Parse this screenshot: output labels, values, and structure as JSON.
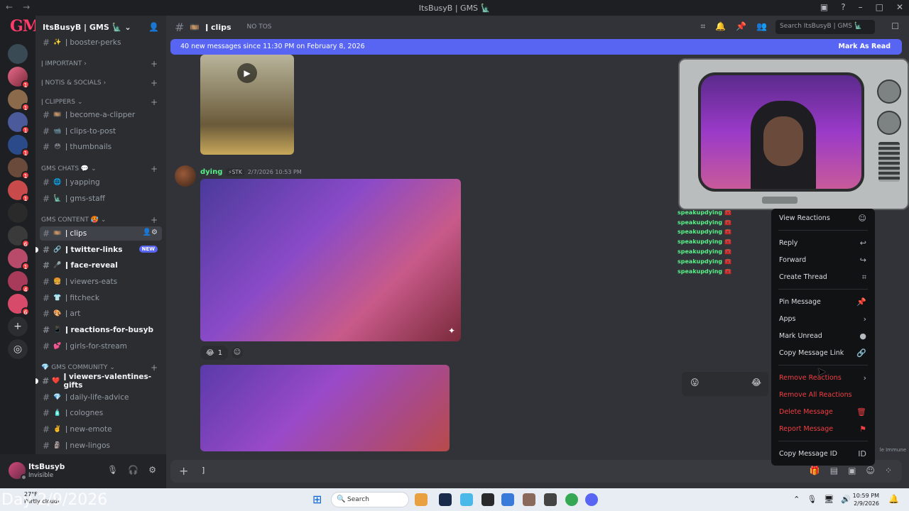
{
  "window": {
    "title": "ItsBusyB | GMS 🗽"
  },
  "server": {
    "name": "ItsBusyB | GMS 🗽"
  },
  "rail_badges": [
    "1",
    "1",
    "1",
    "1",
    "1",
    "1",
    "6",
    "1",
    "4",
    "6"
  ],
  "sidebar": {
    "channels_top": [
      {
        "emoji": "✨",
        "label": "ǀ booster-perks"
      }
    ],
    "categories": {
      "important": "ǀ IMPORTANT",
      "notis": "ǀ NOTIS & SOCIALS",
      "clippers": "ǀ CLIPPERS",
      "chats": "GMS CHATS 💬",
      "content": "GMS CONTENT 🥵",
      "community": "GMS COMMUNITY"
    },
    "clippers": [
      {
        "emoji": "🎞️",
        "label": "ǀ become-a-clipper"
      },
      {
        "emoji": "📹",
        "label": "ǀ clips-to-post"
      },
      {
        "emoji": "😳",
        "label": "ǀ thumbnails"
      }
    ],
    "chats": [
      {
        "emoji": "🌐",
        "label": "ǀ yapping"
      },
      {
        "emoji": "🗽",
        "label": "ǀ gms-staff"
      }
    ],
    "content": [
      {
        "emoji": "🎞️",
        "label": "ǀ clips"
      },
      {
        "emoji": "🔗",
        "label": "ǀ twitter-links",
        "badge": "NEW"
      },
      {
        "emoji": "🎤",
        "label": "ǀ face-reveal"
      },
      {
        "emoji": "🍔",
        "label": "ǀ viewers-eats"
      },
      {
        "emoji": "👕",
        "label": "ǀ fitcheck"
      },
      {
        "emoji": "🎨",
        "label": "ǀ art"
      },
      {
        "emoji": "📱",
        "label": "ǀ reactions-for-busyb"
      },
      {
        "emoji": "💕",
        "label": "ǀ girls-for-stream"
      }
    ],
    "community": [
      {
        "emoji": "❤️",
        "label": "ǀ viewers-valentines-gifts"
      },
      {
        "emoji": "💎",
        "label": "ǀ daily-life-advice"
      },
      {
        "emoji": "🧴",
        "label": "ǀ colognes"
      },
      {
        "emoji": "✌️",
        "label": "ǀ new-emote"
      },
      {
        "emoji": "🗿",
        "label": "ǀ new-lingos"
      }
    ]
  },
  "user": {
    "name": "ItsBusyb",
    "status": "Invisible"
  },
  "channel": {
    "name": "ǀ clips",
    "topic": "NO TOS",
    "search_placeholder": "Search ItsBusyB | GMS 🗽"
  },
  "new_messages": {
    "text": "40 new messages since 11:30 PM on February 8, 2026",
    "mark": "Mark As Read"
  },
  "message": {
    "author": "dying",
    "tag": "⚡STK",
    "time": "2/7/2026 10:53 PM",
    "reaction_emoji": "😂",
    "reaction_count": "1"
  },
  "speakup_lines": [
    "speakupdying 🧰",
    "speakupdying 🧰",
    "speakupdying 🧰",
    "speakupdying 🧰",
    "speakupdying 🧰",
    "speakupdying 🧰",
    "speakupdying 🧰"
  ],
  "context_menu": {
    "view_reactions": "View Reactions",
    "reply": "Reply",
    "forward": "Forward",
    "create_thread": "Create Thread",
    "pin": "Pin Message",
    "apps": "Apps",
    "mark_unread": "Mark Unread",
    "copy_link": "Copy Message Link",
    "remove_reactions": "Remove Reactions",
    "remove_all": "Remove All Reactions",
    "delete": "Delete Message",
    "report": "Report Message",
    "copy_id": "Copy Message ID"
  },
  "side_label": "le Immune",
  "composer": {
    "cursor": "]"
  },
  "taskbar": {
    "weather_temp": "27°F",
    "weather_desc": "Partly cloudy",
    "overlay_date": "Day 2/9/2026",
    "search": "Search",
    "time": "10:59 PM",
    "date": "2/9/2026"
  },
  "colors": {
    "accent": "#5865f2",
    "danger": "#f23f43",
    "online": "#57f287"
  }
}
